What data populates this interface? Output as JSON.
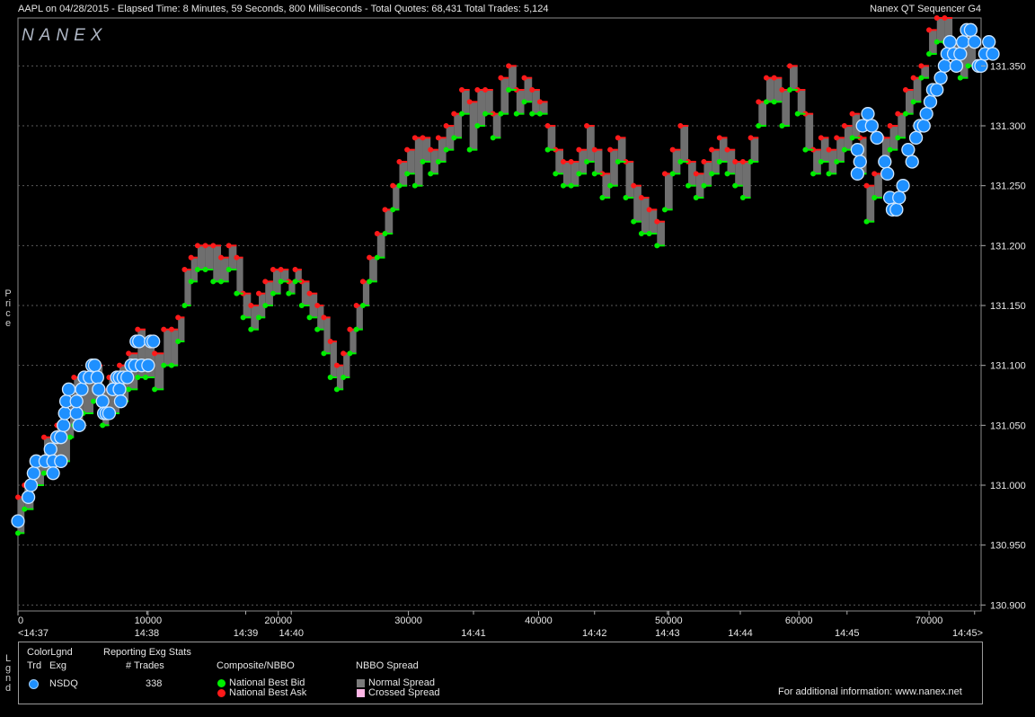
{
  "header": {
    "title": "AAPL on 04/28/2015  -  Elapsed Time: 8 Minutes, 59 Seconds, 800 Milliseconds  -  Total Quotes: 68,431  Total Trades: 5,124",
    "right": "Nanex QT Sequencer G4",
    "logo": "NANEX"
  },
  "side_labels": {
    "price": "Price",
    "legend": "Lgnd"
  },
  "legend": {
    "color_lgnd": "ColorLgnd",
    "trd": "Trd",
    "exg": "Exg",
    "reporting": "Reporting Exg Stats",
    "trades_header": "# Trades",
    "exchange": "NSDQ",
    "trades_count": "338",
    "composite": "Composite/NBBO",
    "best_bid": "National Best Bid",
    "best_ask": "National Best Ask",
    "spread_header": "NBBO Spread",
    "normal_spread": "Normal Spread",
    "crossed_spread": "Crossed Spread",
    "info": "For additional information: www.nanex.net",
    "colors": {
      "trade": "#1e90ff",
      "bid": "#00ee00",
      "ask": "#ff1a1a",
      "normal_spread": "#7a7a7a",
      "crossed_spread": "#ffb6e6"
    }
  },
  "chart_data": {
    "type": "scatter",
    "ylim": [
      130.895,
      131.39
    ],
    "xlim": [
      0,
      74000
    ],
    "y_ticks": [
      130.9,
      130.95,
      131.0,
      131.05,
      131.1,
      131.15,
      131.2,
      131.25,
      131.3,
      131.35
    ],
    "y_tick_labels": [
      "130.900",
      "130.950",
      "131.000",
      "131.050",
      "131.100",
      "131.150",
      "131.200",
      "131.250",
      "131.300",
      "131.350"
    ],
    "x_ticks": [
      0,
      10000,
      20000,
      30000,
      40000,
      50000,
      60000,
      70000
    ],
    "x_tick_labels": [
      "0",
      "10000",
      "20000",
      "30000",
      "40000",
      "50000",
      "60000",
      "70000"
    ],
    "time_ticks": [
      {
        "x": 0,
        "label": "<14:37"
      },
      {
        "x": 9900,
        "label": "14:38"
      },
      {
        "x": 17500,
        "label": "14:39"
      },
      {
        "x": 21000,
        "label": "14:40"
      },
      {
        "x": 35000,
        "label": "14:41"
      },
      {
        "x": 44300,
        "label": "14:42"
      },
      {
        "x": 49900,
        "label": "14:43"
      },
      {
        "x": 55500,
        "label": "14:44"
      },
      {
        "x": 63700,
        "label": "14:45"
      },
      {
        "x": 73500,
        "label": "14:45>"
      }
    ],
    "nbbo": [
      {
        "x": 0,
        "bid": 130.96,
        "ask": 130.99
      },
      {
        "x": 500,
        "bid": 130.98,
        "ask": 131.0
      },
      {
        "x": 1200,
        "bid": 131.0,
        "ask": 131.02
      },
      {
        "x": 2000,
        "bid": 131.01,
        "ask": 131.04
      },
      {
        "x": 3000,
        "bid": 131.02,
        "ask": 131.05
      },
      {
        "x": 4000,
        "bid": 131.04,
        "ask": 131.07
      },
      {
        "x": 4300,
        "bid": 131.05,
        "ask": 131.09
      },
      {
        "x": 5000,
        "bid": 131.06,
        "ask": 131.09
      },
      {
        "x": 5800,
        "bid": 131.07,
        "ask": 131.1
      },
      {
        "x": 6500,
        "bid": 131.05,
        "ask": 131.08
      },
      {
        "x": 7000,
        "bid": 131.06,
        "ask": 131.09
      },
      {
        "x": 7800,
        "bid": 131.07,
        "ask": 131.1
      },
      {
        "x": 8500,
        "bid": 131.08,
        "ask": 131.11
      },
      {
        "x": 9200,
        "bid": 131.09,
        "ask": 131.13
      },
      {
        "x": 9800,
        "bid": 131.09,
        "ask": 131.12
      },
      {
        "x": 10500,
        "bid": 131.08,
        "ask": 131.11
      },
      {
        "x": 11200,
        "bid": 131.1,
        "ask": 131.13
      },
      {
        "x": 11800,
        "bid": 131.1,
        "ask": 131.13
      },
      {
        "x": 12300,
        "bid": 131.12,
        "ask": 131.14
      },
      {
        "x": 12800,
        "bid": 131.15,
        "ask": 131.18
      },
      {
        "x": 13300,
        "bid": 131.17,
        "ask": 131.19
      },
      {
        "x": 13800,
        "bid": 131.18,
        "ask": 131.2
      },
      {
        "x": 14400,
        "bid": 131.18,
        "ask": 131.2
      },
      {
        "x": 15000,
        "bid": 131.17,
        "ask": 131.2
      },
      {
        "x": 15600,
        "bid": 131.17,
        "ask": 131.19
      },
      {
        "x": 16200,
        "bid": 131.18,
        "ask": 131.2
      },
      {
        "x": 16800,
        "bid": 131.16,
        "ask": 131.19
      },
      {
        "x": 17300,
        "bid": 131.14,
        "ask": 131.16
      },
      {
        "x": 17900,
        "bid": 131.13,
        "ask": 131.15
      },
      {
        "x": 18500,
        "bid": 131.14,
        "ask": 131.16
      },
      {
        "x": 19000,
        "bid": 131.15,
        "ask": 131.17
      },
      {
        "x": 19600,
        "bid": 131.16,
        "ask": 131.18
      },
      {
        "x": 20200,
        "bid": 131.17,
        "ask": 131.18
      },
      {
        "x": 20800,
        "bid": 131.16,
        "ask": 131.17
      },
      {
        "x": 21300,
        "bid": 131.17,
        "ask": 131.18
      },
      {
        "x": 21800,
        "bid": 131.15,
        "ask": 131.17
      },
      {
        "x": 22400,
        "bid": 131.14,
        "ask": 131.16
      },
      {
        "x": 23000,
        "bid": 131.13,
        "ask": 131.15
      },
      {
        "x": 23500,
        "bid": 131.11,
        "ask": 131.14
      },
      {
        "x": 24000,
        "bid": 131.09,
        "ask": 131.12
      },
      {
        "x": 24500,
        "bid": 131.08,
        "ask": 131.1
      },
      {
        "x": 25000,
        "bid": 131.09,
        "ask": 131.11
      },
      {
        "x": 25500,
        "bid": 131.11,
        "ask": 131.13
      },
      {
        "x": 26000,
        "bid": 131.13,
        "ask": 131.15
      },
      {
        "x": 26500,
        "bid": 131.15,
        "ask": 131.17
      },
      {
        "x": 27000,
        "bid": 131.17,
        "ask": 131.19
      },
      {
        "x": 27600,
        "bid": 131.19,
        "ask": 131.21
      },
      {
        "x": 28200,
        "bid": 131.21,
        "ask": 131.23
      },
      {
        "x": 28800,
        "bid": 131.23,
        "ask": 131.25
      },
      {
        "x": 29300,
        "bid": 131.25,
        "ask": 131.27
      },
      {
        "x": 29900,
        "bid": 131.26,
        "ask": 131.28
      },
      {
        "x": 30500,
        "bid": 131.25,
        "ask": 131.29
      },
      {
        "x": 31100,
        "bid": 131.27,
        "ask": 131.29
      },
      {
        "x": 31700,
        "bid": 131.26,
        "ask": 131.28
      },
      {
        "x": 32300,
        "bid": 131.27,
        "ask": 131.29
      },
      {
        "x": 32900,
        "bid": 131.28,
        "ask": 131.3
      },
      {
        "x": 33500,
        "bid": 131.29,
        "ask": 131.31
      },
      {
        "x": 34100,
        "bid": 131.31,
        "ask": 131.33
      },
      {
        "x": 34700,
        "bid": 131.28,
        "ask": 131.32
      },
      {
        "x": 35300,
        "bid": 131.3,
        "ask": 131.33
      },
      {
        "x": 35900,
        "bid": 131.31,
        "ask": 131.33
      },
      {
        "x": 36500,
        "bid": 131.29,
        "ask": 131.31
      },
      {
        "x": 37100,
        "bid": 131.31,
        "ask": 131.34
      },
      {
        "x": 37700,
        "bid": 131.33,
        "ask": 131.35
      },
      {
        "x": 38300,
        "bid": 131.31,
        "ask": 131.33
      },
      {
        "x": 38900,
        "bid": 131.32,
        "ask": 131.34
      },
      {
        "x": 39500,
        "bid": 131.31,
        "ask": 131.33
      },
      {
        "x": 40100,
        "bid": 131.31,
        "ask": 131.32
      },
      {
        "x": 40700,
        "bid": 131.28,
        "ask": 131.3
      },
      {
        "x": 41300,
        "bid": 131.26,
        "ask": 131.28
      },
      {
        "x": 41900,
        "bid": 131.25,
        "ask": 131.27
      },
      {
        "x": 42500,
        "bid": 131.25,
        "ask": 131.27
      },
      {
        "x": 43100,
        "bid": 131.26,
        "ask": 131.28
      },
      {
        "x": 43700,
        "bid": 131.27,
        "ask": 131.3
      },
      {
        "x": 44300,
        "bid": 131.26,
        "ask": 131.28
      },
      {
        "x": 44900,
        "bid": 131.24,
        "ask": 131.26
      },
      {
        "x": 45500,
        "bid": 131.25,
        "ask": 131.28
      },
      {
        "x": 46100,
        "bid": 131.27,
        "ask": 131.29
      },
      {
        "x": 46700,
        "bid": 131.24,
        "ask": 131.27
      },
      {
        "x": 47300,
        "bid": 131.22,
        "ask": 131.25
      },
      {
        "x": 47900,
        "bid": 131.21,
        "ask": 131.24
      },
      {
        "x": 48500,
        "bid": 131.21,
        "ask": 131.23
      },
      {
        "x": 49100,
        "bid": 131.2,
        "ask": 131.22
      },
      {
        "x": 49700,
        "bid": 131.23,
        "ask": 131.26
      },
      {
        "x": 50300,
        "bid": 131.26,
        "ask": 131.28
      },
      {
        "x": 50900,
        "bid": 131.27,
        "ask": 131.3
      },
      {
        "x": 51500,
        "bid": 131.25,
        "ask": 131.27
      },
      {
        "x": 52100,
        "bid": 131.24,
        "ask": 131.26
      },
      {
        "x": 52700,
        "bid": 131.25,
        "ask": 131.27
      },
      {
        "x": 53300,
        "bid": 131.26,
        "ask": 131.28
      },
      {
        "x": 53900,
        "bid": 131.27,
        "ask": 131.29
      },
      {
        "x": 54500,
        "bid": 131.26,
        "ask": 131.28
      },
      {
        "x": 55100,
        "bid": 131.25,
        "ask": 131.27
      },
      {
        "x": 55700,
        "bid": 131.24,
        "ask": 131.27
      },
      {
        "x": 56300,
        "bid": 131.27,
        "ask": 131.29
      },
      {
        "x": 56900,
        "bid": 131.3,
        "ask": 131.32
      },
      {
        "x": 57500,
        "bid": 131.32,
        "ask": 131.34
      },
      {
        "x": 58100,
        "bid": 131.32,
        "ask": 131.34
      },
      {
        "x": 58700,
        "bid": 131.3,
        "ask": 131.33
      },
      {
        "x": 59300,
        "bid": 131.33,
        "ask": 131.35
      },
      {
        "x": 59900,
        "bid": 131.31,
        "ask": 131.33
      },
      {
        "x": 60500,
        "bid": 131.28,
        "ask": 131.31
      },
      {
        "x": 61100,
        "bid": 131.26,
        "ask": 131.28
      },
      {
        "x": 61700,
        "bid": 131.27,
        "ask": 131.29
      },
      {
        "x": 62300,
        "bid": 131.26,
        "ask": 131.28
      },
      {
        "x": 62900,
        "bid": 131.27,
        "ask": 131.29
      },
      {
        "x": 63500,
        "bid": 131.28,
        "ask": 131.3
      },
      {
        "x": 64100,
        "bid": 131.29,
        "ask": 131.31
      },
      {
        "x": 64700,
        "bid": 131.26,
        "ask": 131.29
      },
      {
        "x": 65200,
        "bid": 131.22,
        "ask": 131.25
      },
      {
        "x": 65800,
        "bid": 131.24,
        "ask": 131.26
      },
      {
        "x": 66400,
        "bid": 131.27,
        "ask": 131.29
      },
      {
        "x": 67000,
        "bid": 131.28,
        "ask": 131.3
      },
      {
        "x": 67600,
        "bid": 131.29,
        "ask": 131.31
      },
      {
        "x": 68200,
        "bid": 131.31,
        "ask": 131.33
      },
      {
        "x": 68800,
        "bid": 131.32,
        "ask": 131.34
      },
      {
        "x": 69400,
        "bid": 131.34,
        "ask": 131.35
      },
      {
        "x": 70000,
        "bid": 131.36,
        "ask": 131.38
      },
      {
        "x": 70600,
        "bid": 131.37,
        "ask": 131.39
      },
      {
        "x": 71200,
        "bid": 131.37,
        "ask": 131.39
      },
      {
        "x": 71800,
        "bid": 131.35,
        "ask": 131.37
      },
      {
        "x": 72400,
        "bid": 131.34,
        "ask": 131.37
      },
      {
        "x": 73000,
        "bid": 131.35,
        "ask": 131.38
      }
    ],
    "trades": [
      {
        "x": 0,
        "price": 130.97
      },
      {
        "x": 800,
        "price": 130.99
      },
      {
        "x": 1000,
        "price": 131.0
      },
      {
        "x": 1200,
        "price": 131.01
      },
      {
        "x": 1400,
        "price": 131.02
      },
      {
        "x": 2100,
        "price": 131.02
      },
      {
        "x": 2500,
        "price": 131.03
      },
      {
        "x": 2700,
        "price": 131.02
      },
      {
        "x": 2700,
        "price": 131.01
      },
      {
        "x": 3000,
        "price": 131.04
      },
      {
        "x": 3300,
        "price": 131.02
      },
      {
        "x": 3300,
        "price": 131.04
      },
      {
        "x": 3500,
        "price": 131.05
      },
      {
        "x": 3600,
        "price": 131.06
      },
      {
        "x": 3700,
        "price": 131.07
      },
      {
        "x": 3900,
        "price": 131.08
      },
      {
        "x": 4500,
        "price": 131.06
      },
      {
        "x": 4500,
        "price": 131.07
      },
      {
        "x": 4700,
        "price": 131.05
      },
      {
        "x": 4900,
        "price": 131.08
      },
      {
        "x": 5100,
        "price": 131.09
      },
      {
        "x": 5500,
        "price": 131.09
      },
      {
        "x": 5700,
        "price": 131.1
      },
      {
        "x": 5900,
        "price": 131.1
      },
      {
        "x": 6100,
        "price": 131.09
      },
      {
        "x": 6200,
        "price": 131.08
      },
      {
        "x": 6500,
        "price": 131.07
      },
      {
        "x": 6600,
        "price": 131.06
      },
      {
        "x": 6800,
        "price": 131.06
      },
      {
        "x": 7000,
        "price": 131.06
      },
      {
        "x": 7300,
        "price": 131.08
      },
      {
        "x": 7600,
        "price": 131.09
      },
      {
        "x": 7800,
        "price": 131.09
      },
      {
        "x": 7800,
        "price": 131.08
      },
      {
        "x": 7900,
        "price": 131.07
      },
      {
        "x": 8100,
        "price": 131.09
      },
      {
        "x": 8400,
        "price": 131.09
      },
      {
        "x": 8700,
        "price": 131.1
      },
      {
        "x": 9000,
        "price": 131.1
      },
      {
        "x": 9100,
        "price": 131.12
      },
      {
        "x": 9300,
        "price": 131.12
      },
      {
        "x": 9500,
        "price": 131.1
      },
      {
        "x": 10000,
        "price": 131.1
      },
      {
        "x": 10200,
        "price": 131.12
      },
      {
        "x": 10400,
        "price": 131.12
      },
      {
        "x": 64500,
        "price": 131.26
      },
      {
        "x": 64500,
        "price": 131.28
      },
      {
        "x": 64700,
        "price": 131.27
      },
      {
        "x": 64900,
        "price": 131.3
      },
      {
        "x": 65300,
        "price": 131.31
      },
      {
        "x": 65600,
        "price": 131.3
      },
      {
        "x": 66000,
        "price": 131.29
      },
      {
        "x": 66600,
        "price": 131.27
      },
      {
        "x": 66800,
        "price": 131.26
      },
      {
        "x": 67000,
        "price": 131.24
      },
      {
        "x": 67200,
        "price": 131.23
      },
      {
        "x": 67500,
        "price": 131.23
      },
      {
        "x": 67700,
        "price": 131.24
      },
      {
        "x": 68000,
        "price": 131.25
      },
      {
        "x": 68400,
        "price": 131.28
      },
      {
        "x": 68700,
        "price": 131.27
      },
      {
        "x": 69000,
        "price": 131.29
      },
      {
        "x": 69300,
        "price": 131.3
      },
      {
        "x": 69600,
        "price": 131.3
      },
      {
        "x": 69800,
        "price": 131.31
      },
      {
        "x": 70100,
        "price": 131.32
      },
      {
        "x": 70300,
        "price": 131.33
      },
      {
        "x": 70600,
        "price": 131.33
      },
      {
        "x": 70900,
        "price": 131.34
      },
      {
        "x": 71200,
        "price": 131.35
      },
      {
        "x": 71400,
        "price": 131.36
      },
      {
        "x": 71600,
        "price": 131.37
      },
      {
        "x": 71900,
        "price": 131.36
      },
      {
        "x": 72100,
        "price": 131.35
      },
      {
        "x": 72400,
        "price": 131.36
      },
      {
        "x": 72600,
        "price": 131.37
      },
      {
        "x": 72900,
        "price": 131.38
      },
      {
        "x": 73200,
        "price": 131.38
      },
      {
        "x": 73500,
        "price": 131.37
      },
      {
        "x": 73800,
        "price": 131.35
      },
      {
        "x": 74000,
        "price": 131.35
      },
      {
        "x": 74300,
        "price": 131.36
      },
      {
        "x": 74600,
        "price": 131.37
      },
      {
        "x": 74900,
        "price": 131.36
      }
    ]
  }
}
